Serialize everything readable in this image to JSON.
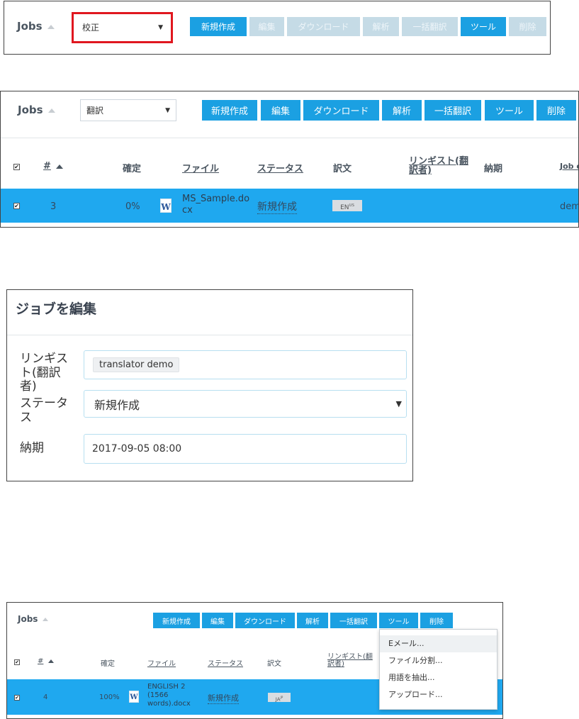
{
  "panel1": {
    "jobs_label": "Jobs",
    "select_value": "校正",
    "buttons": [
      "新規作成",
      "編集",
      "ダウンロード",
      "解析",
      "一括翻訳",
      "ツール",
      "削除"
    ],
    "highlight_color": "#e0171f"
  },
  "panel2": {
    "jobs_label": "Jobs",
    "select_value": "翻訳",
    "buttons": [
      "新規作成",
      "編集",
      "ダウンロード",
      "解析",
      "一括翻訳",
      "ツール",
      "削除"
    ],
    "headers": {
      "num": "#",
      "confirmed": "確定",
      "file": "ファイル",
      "status": "ステータス",
      "target": "訳文",
      "linguist": "リンギスト(翻訳者)",
      "due": "納期",
      "job": "Job o"
    },
    "row": {
      "num": "3",
      "confirmed": "0%",
      "file": "MS_Sample.docx",
      "status": "新規作成",
      "lang": "EN",
      "lang_sup": "US",
      "job": "dem"
    }
  },
  "dialog": {
    "title": "ジョブを編集",
    "linguist_label": "リンギスト(翻訳者)",
    "linguist_value": "translator demo",
    "status_label": "ステータス",
    "status_value": "新規作成",
    "due_label": "納期",
    "due_value": "2017-09-05 08:00"
  },
  "panel4": {
    "jobs_label": "Jobs",
    "buttons": [
      "新規作成",
      "編集",
      "ダウンロード",
      "解析",
      "一括翻訳",
      "ツール",
      "削除"
    ],
    "headers": {
      "num": "#",
      "confirmed": "確定",
      "file": "ファイル",
      "status": "ステータス",
      "target": "訳文",
      "linguist": "リンギスト(翻訳者)"
    },
    "row": {
      "num": "4",
      "confirmed": "100%",
      "file": "ENGLISH 2 (1566 words).docx",
      "status": "新規作成",
      "lang": "JA",
      "lang_sup": "JP"
    },
    "menu": [
      "Eメール...",
      "ファイル分割...",
      "用語を抽出...",
      "アップロード..."
    ]
  },
  "colors": {
    "accent": "#1ba0e2",
    "row_highlight": "#1fa8ef",
    "disabled": "#c5dbe6"
  }
}
